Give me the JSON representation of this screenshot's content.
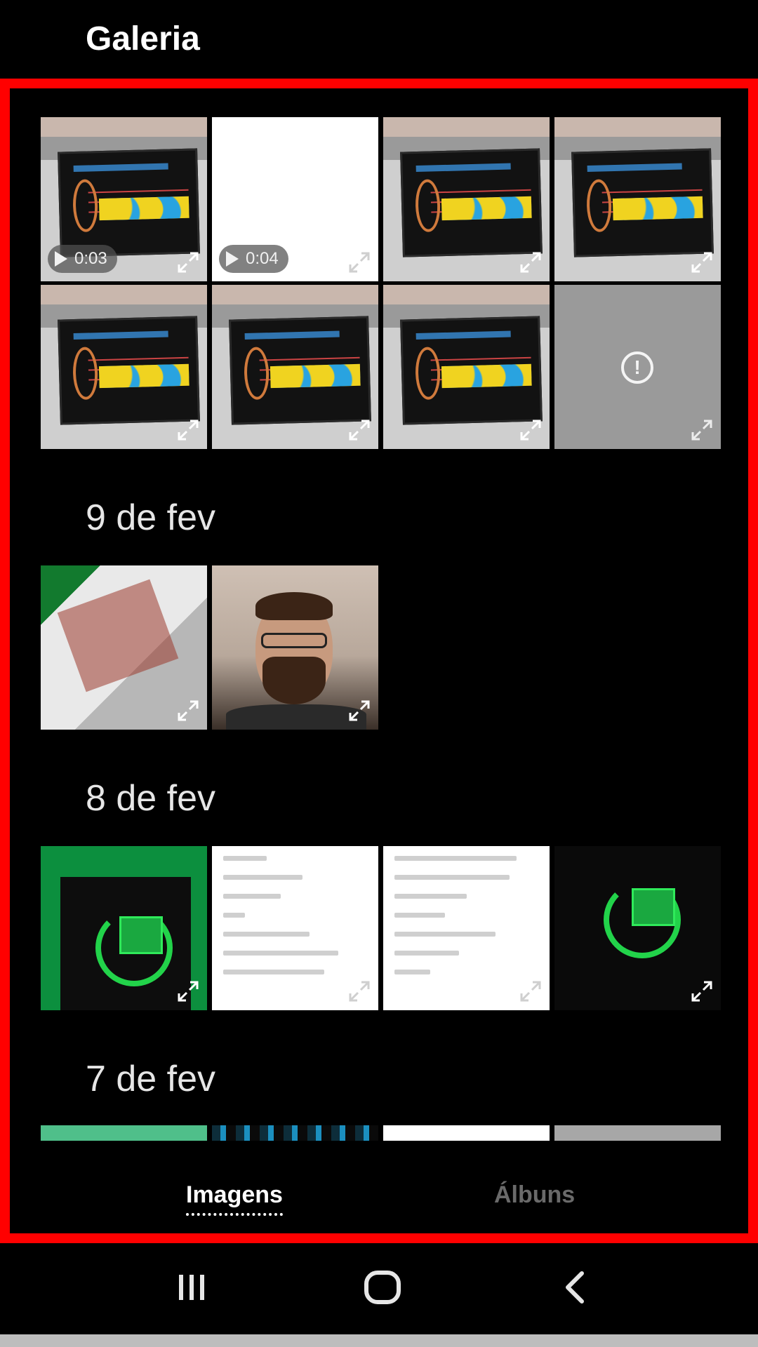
{
  "header": {
    "title": "Galeria"
  },
  "sections": [
    {
      "date": "9 de fev"
    },
    {
      "date": "8 de fev"
    },
    {
      "date": "7 de fev"
    }
  ],
  "videos": [
    {
      "duration": "0:03"
    },
    {
      "duration": "0:04"
    }
  ],
  "tabs": [
    {
      "label": "Imagens",
      "active": true
    },
    {
      "label": "Álbuns",
      "active": false
    }
  ],
  "icons": {
    "expand": "expand-icon",
    "play": "play-icon",
    "error": "error-icon",
    "nav_recents": "recent-apps-icon",
    "nav_home": "home-icon",
    "nav_back": "back-icon"
  },
  "colors": {
    "frame": "#ff0000",
    "background": "#000000",
    "tab_active": "#ffffff",
    "tab_inactive": "#6a6a6a"
  }
}
